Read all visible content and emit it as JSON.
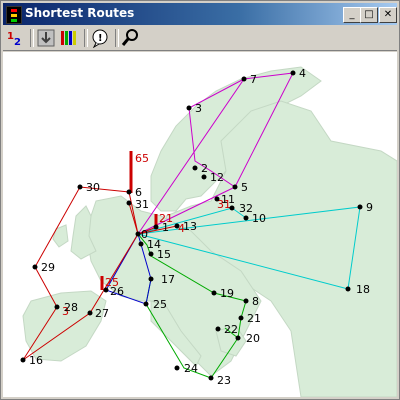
{
  "window": {
    "title": "Shortest Routes"
  },
  "titlebar_buttons": {
    "minimize": "_",
    "maximize": "□",
    "close": "✕"
  },
  "toolbar": [
    {
      "name": "numbering-tool",
      "icon": "numbering-icon",
      "text": "12"
    },
    {
      "name": "download-tool",
      "icon": "arrow-down-icon",
      "text": ""
    },
    {
      "name": "bars-tool",
      "icon": "bar-chart-icon",
      "text": ""
    },
    {
      "name": "info-tool",
      "icon": "info-icon",
      "text": ""
    },
    {
      "name": "search-tool",
      "icon": "magnifier-icon",
      "text": ""
    }
  ],
  "colors": {
    "route_a": "#cc00cc",
    "route_b": "#00cccc",
    "route_c": "#00aa00",
    "route_d": "#0000cc",
    "route_e": "#cc0000",
    "land": "#d8ecd8"
  },
  "nodes": {
    "0": "0",
    "1": "1",
    "2": "2",
    "3": "3",
    "4": "4",
    "5": "5",
    "6": "6",
    "7": "7",
    "8": "8",
    "9": "9",
    "10": "10",
    "11": "11",
    "12": "12",
    "13": "13",
    "14": "14",
    "15": "15",
    "16": "16",
    "17": "17",
    "18": "18",
    "19": "19",
    "20": "20",
    "21": "21",
    "22": "22",
    "23": "23",
    "24": "24",
    "25": "25",
    "26": "26",
    "27": "27",
    "28": "28",
    "29": "29",
    "30": "30",
    "31": "31",
    "32": "32"
  },
  "markers": {
    "m65": "65",
    "m21": "21",
    "m25": "25",
    "m31": "31",
    "m4": "4",
    "m3": "3"
  }
}
